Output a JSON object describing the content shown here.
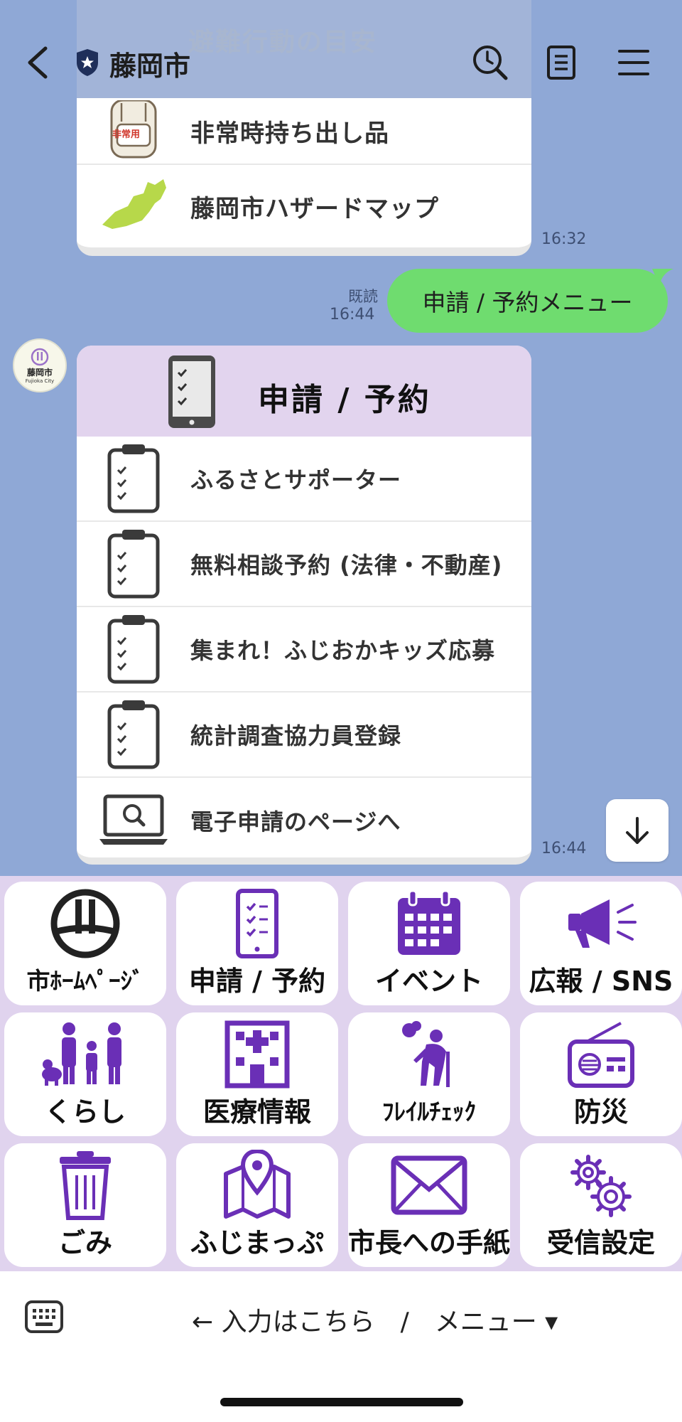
{
  "header": {
    "title": "藤岡市",
    "ghost_title": "避難行動の目安"
  },
  "card1": {
    "items": [
      {
        "label": "非常時持ち出し品",
        "thumb_text": "非常用"
      },
      {
        "label": "藤岡市ハザードマップ"
      }
    ],
    "time": "16:32"
  },
  "sent": {
    "text": "申請 / 予約メニュー",
    "read": "既読",
    "time": "16:44"
  },
  "avatar": {
    "main": "藤岡市",
    "sub": "Fujioka City"
  },
  "card2": {
    "title": "申請 / 予約",
    "items": [
      {
        "label": "ふるさとサポーター"
      },
      {
        "label": "無料相談予約 (法律・不動産)"
      },
      {
        "label": "集まれ！ふじおかキッズ応募"
      },
      {
        "label": "統計調査協力員登録"
      },
      {
        "label": "電子申請のページへ"
      }
    ],
    "time": "16:44"
  },
  "rich_menu": {
    "tiles": [
      {
        "label": "市ﾎｰﾑﾍﾟｰｼﾞ",
        "icon": "city-emblem-icon"
      },
      {
        "label": "申請 / 予約",
        "icon": "smartphone-checklist-icon"
      },
      {
        "label": "イベント",
        "icon": "calendar-icon"
      },
      {
        "label": "広報 / SNS",
        "icon": "megaphone-icon"
      },
      {
        "label": "くらし",
        "icon": "family-icon"
      },
      {
        "label": "医療情報",
        "icon": "hospital-icon"
      },
      {
        "label": "ﾌﾚｲﾙﾁｪｯｸ",
        "icon": "elderly-person-icon"
      },
      {
        "label": "防災",
        "icon": "radio-icon"
      },
      {
        "label": "ごみ",
        "icon": "trash-can-icon"
      },
      {
        "label": "ふじまっぷ",
        "icon": "map-pin-icon"
      },
      {
        "label": "市長への手紙",
        "icon": "envelope-icon"
      },
      {
        "label": "受信設定",
        "icon": "gears-icon"
      }
    ]
  },
  "bottom": {
    "menu_label": "← 入力はこちら　/　メニュー ▾"
  },
  "colors": {
    "chat_bg": "#8fa8d6",
    "sent_bubble": "#6fdc6f",
    "menu_bg": "#e0d3ee",
    "accent_purple": "#6a2fb6",
    "card_header": "#e2d4ee"
  }
}
